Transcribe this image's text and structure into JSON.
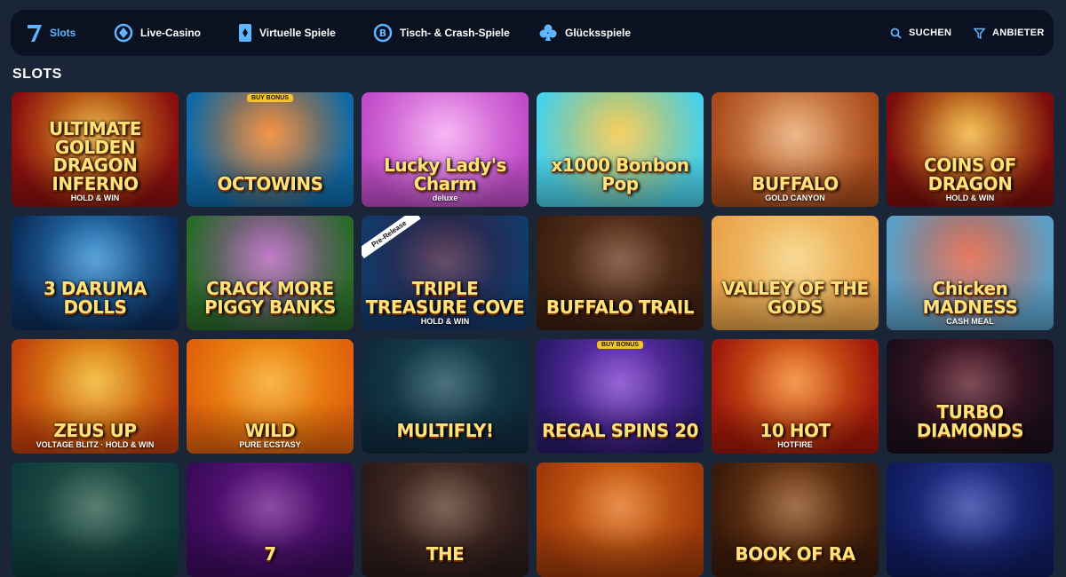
{
  "nav": {
    "items": [
      {
        "label": "Slots",
        "icon": "seven-icon",
        "active": true
      },
      {
        "label": "Live-Casino",
        "icon": "casino-chip-icon",
        "active": false
      },
      {
        "label": "Virtuelle Spiele",
        "icon": "card-icon",
        "active": false
      },
      {
        "label": "Tisch- & Crash-Spiele",
        "icon": "bitcoin-coin-icon",
        "active": false
      },
      {
        "label": "Glücksspiele",
        "icon": "club-icon",
        "active": false
      }
    ],
    "search_label": "SUCHEN",
    "provider_label": "ANBIETER"
  },
  "section": {
    "title": "SLOTS"
  },
  "games": [
    {
      "title": "ULTIMATE GOLDEN DRAGON INFERNO",
      "sub": "HOLD & WIN",
      "badge": "",
      "colors": [
        "#8a0e0e",
        "#e0a020"
      ]
    },
    {
      "title": "OCTOWINS",
      "sub": "",
      "badge": "BUY BONUS",
      "colors": [
        "#0f6aa8",
        "#f07a1a"
      ]
    },
    {
      "title": "Lucky Lady's Charm",
      "sub": "deluxe",
      "badge": "",
      "colors": [
        "#c14cc9",
        "#f3a4f0"
      ]
    },
    {
      "title": "x1000 Bonbon Pop",
      "sub": "",
      "badge": "",
      "colors": [
        "#4ad0e8",
        "#f4c43a"
      ]
    },
    {
      "title": "BUFFALO",
      "sub": "GOLD CANYON",
      "badge": "",
      "colors": [
        "#a94a1a",
        "#e6a56a"
      ]
    },
    {
      "title": "COINS OF DRAGON",
      "sub": "HOLD & WIN",
      "badge": "",
      "colors": [
        "#7a0c0c",
        "#f0b030"
      ]
    },
    {
      "title": "3 DARUMA DOLLS",
      "sub": "",
      "badge": "",
      "colors": [
        "#0c2d5a",
        "#2f8ad0"
      ]
    },
    {
      "title": "CRACK MORE PIGGY BANKS",
      "sub": "",
      "badge": "",
      "colors": [
        "#2a6a2a",
        "#b05ab8"
      ]
    },
    {
      "title": "TRIPLE TREASURE COVE",
      "sub": "HOLD & WIN",
      "badge": "Pre-Release",
      "colors": [
        "#123a6a",
        "#3a1a3a"
      ]
    },
    {
      "title": "BUFFALO TRAIL",
      "sub": "",
      "badge": "",
      "colors": [
        "#3a1f10",
        "#6a3a20"
      ]
    },
    {
      "title": "VALLEY OF THE GODS",
      "sub": "",
      "badge": "",
      "colors": [
        "#e8a24a",
        "#f5d07a"
      ]
    },
    {
      "title": "Chicken MADNESS",
      "sub": "CASH MEAL",
      "badge": "",
      "colors": [
        "#5aa0c8",
        "#e05a3a"
      ]
    },
    {
      "title": "ZEUS UP",
      "sub": "VOLTAGE BLITZ · HOLD & WIN",
      "badge": "",
      "colors": [
        "#c0400a",
        "#f0b020"
      ]
    },
    {
      "title": "WILD",
      "sub": "PURE ECSTASY",
      "badge": "",
      "colors": [
        "#e0620a",
        "#f5a21a"
      ]
    },
    {
      "title": "MULTIFLY!",
      "sub": "",
      "badge": "",
      "colors": [
        "#0e2a3a",
        "#1a4a5a"
      ]
    },
    {
      "title": "REGAL SPINS 20",
      "sub": "",
      "badge": "BUY BONUS",
      "colors": [
        "#2a1a6a",
        "#7a3aca"
      ]
    },
    {
      "title": "10 HOT",
      "sub": "HOTFIRE",
      "badge": "",
      "colors": [
        "#a0180a",
        "#f08020"
      ]
    },
    {
      "title": "TURBO DIAMONDS",
      "sub": "",
      "badge": "",
      "colors": [
        "#1a0e1a",
        "#5a1a2a"
      ]
    },
    {
      "title": "",
      "sub": "",
      "badge": "",
      "colors": [
        "#0e3a3a",
        "#2a5a4a"
      ]
    },
    {
      "title": "7",
      "sub": "",
      "badge": "",
      "colors": [
        "#3a0a5a",
        "#6a1a8a"
      ]
    },
    {
      "title": "THE",
      "sub": "",
      "badge": "",
      "colors": [
        "#2a1a1a",
        "#5a3a2a"
      ]
    },
    {
      "title": "",
      "sub": "",
      "badge": "",
      "colors": [
        "#a03a0a",
        "#e0701a"
      ]
    },
    {
      "title": "BOOK OF RA",
      "sub": "",
      "badge": "",
      "colors": [
        "#3a1a0a",
        "#8a4a1a"
      ]
    },
    {
      "title": "",
      "sub": "",
      "badge": "",
      "colors": [
        "#0e1a5a",
        "#2a3aa0"
      ]
    }
  ]
}
